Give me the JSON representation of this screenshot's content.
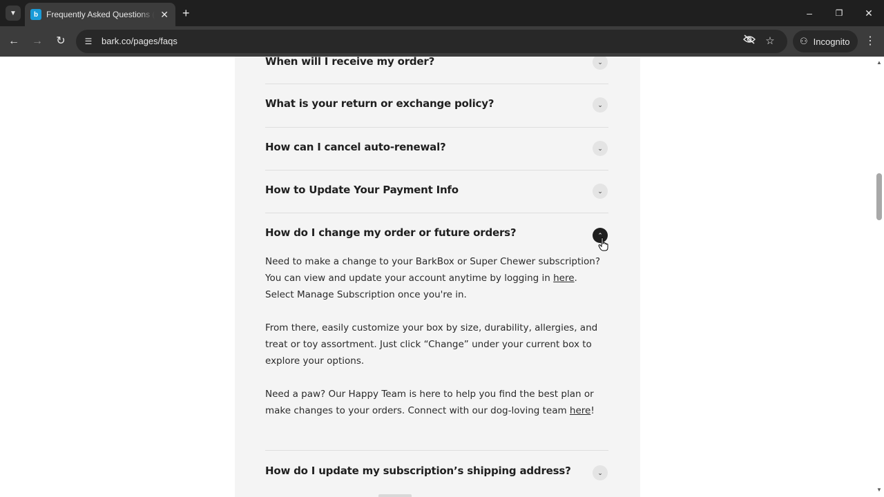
{
  "browser": {
    "tab_title": "Frequently Asked Questions (FAQs)",
    "favicon_letter": "b",
    "url": "bark.co/pages/faqs",
    "incognito_label": "Incognito",
    "icons": {
      "tab_search": "chevron-down-icon",
      "close_tab": "close-icon",
      "new_tab": "plus-icon",
      "back": "arrow-left-icon",
      "forward": "arrow-right-icon",
      "reload": "reload-icon",
      "site_info": "tune-icon",
      "eye_off": "eye-off-icon",
      "bookmark": "star-icon",
      "incognito": "incognito-icon",
      "menu": "kebab-menu-icon"
    }
  },
  "faq": {
    "questions": [
      {
        "label": "When will I receive my order?",
        "expanded": false
      },
      {
        "label": "What is your return or exchange policy?",
        "expanded": false
      },
      {
        "label": "How can I cancel auto-renewal?",
        "expanded": false
      },
      {
        "label": "How to Update Your Payment Info",
        "expanded": false
      },
      {
        "label": "How do I change my order or future orders?",
        "expanded": true
      },
      {
        "label": "How do I update my subscription’s shipping address?",
        "expanded": false
      }
    ],
    "answer": {
      "p1_before": "Need to make a change to your BarkBox or Super Chewer subscription? You can view and update your account anytime by logging in ",
      "p1_link": "here",
      "p1_after": ". Select Manage Subscription once you're in.",
      "p2": "From there, easily customize your box by size, durability, allergies, and treat or toy assortment. Just click “Change” under your current box to explore your options.",
      "p3_before": "Need a paw? Our Happy Team is here to help you find the best plan or make changes to your orders. Connect with our dog-loving team ",
      "p3_link": "here",
      "p3_after": "!"
    }
  },
  "colors": {
    "panel_bg": "#f4f4f4",
    "chrome_dark": "#1f1f1f",
    "toolbar": "#3c3c3c",
    "favicon": "#1a9bd7"
  }
}
